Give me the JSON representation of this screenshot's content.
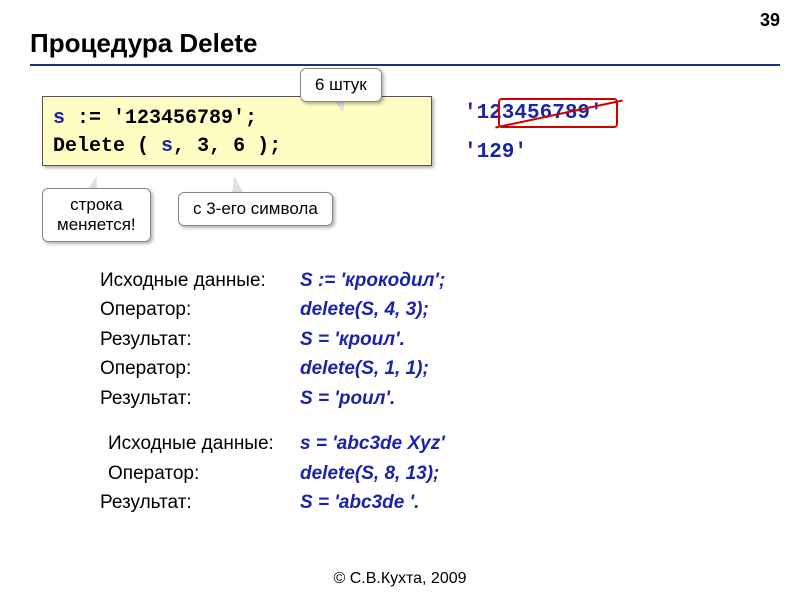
{
  "page_number": "39",
  "title": "Процедура Delete",
  "code": {
    "line1_s": "s",
    "line1_rest": " := '123456789';",
    "line2_a": "Delete ( ",
    "line2_s": "s",
    "line2_b": ", ",
    "line2_n1": "3",
    "line2_c": ", ",
    "line2_n2": "6",
    "line2_d": " );"
  },
  "callouts": {
    "six": "6 штук",
    "strchange_l1": "строка",
    "strchange_l2": "меняется!",
    "third": "с 3-его символа"
  },
  "right": {
    "full": "'123456789'",
    "result": "'129'"
  },
  "ex1": {
    "l1_label": "Исходные данные:",
    "l1_val": "S := 'крокодил';",
    "l2_label": "Оператор:",
    "l2_val": "delete(S, 4, 3);",
    "l3_label": "Результат:",
    "l3_val": "S = 'кроил'.",
    "l4_label": "Оператор:",
    "l4_val": "delete(S, 1, 1);",
    "l5_label": "Результат:",
    "l5_val": "S = 'роил'."
  },
  "ex2": {
    "l1_label": "Исходные данные:",
    "l1_val": "s = 'abc3de Xyz'",
    "l2_label": "Оператор:",
    "l2_val": "delete(S, 8, 13);",
    "l3_label": "Результат:",
    "l3_val": "S = 'abc3de '."
  },
  "footer": "© С.В.Кухта, 2009"
}
